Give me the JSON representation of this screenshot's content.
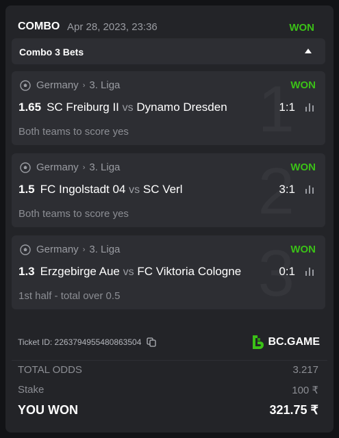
{
  "header": {
    "title": "COMBO",
    "date": "Apr 28, 2023, 23:36",
    "status": "WON"
  },
  "combo_bar": {
    "label": "Combo 3 Bets"
  },
  "bets": [
    {
      "number": "1",
      "country": "Germany",
      "league": "3. Liga",
      "status": "WON",
      "odds": "1.65",
      "home": "SC Freiburg II",
      "vs": "vs",
      "away": "Dynamo Dresden",
      "score": "1:1",
      "market": "Both teams to score yes"
    },
    {
      "number": "2",
      "country": "Germany",
      "league": "3. Liga",
      "status": "WON",
      "odds": "1.5",
      "home": "FC Ingolstadt 04",
      "vs": "vs",
      "away": "SC Verl",
      "score": "3:1",
      "market": "Both teams to score yes"
    },
    {
      "number": "3",
      "country": "Germany",
      "league": "3. Liga",
      "status": "WON",
      "odds": "1.3",
      "home": "Erzgebirge Aue",
      "vs": "vs",
      "away": "FC Viktoria Cologne",
      "score": "0:1",
      "market": "1st half - total over 0.5"
    }
  ],
  "ticket": {
    "label": "Ticket ID: 226379495548086350​4",
    "brand": "BC.GAME"
  },
  "summary": {
    "total_odds_label": "TOTAL ODDS",
    "total_odds_value": "3.217",
    "stake_label": "Stake",
    "stake_value": "100 ₹",
    "won_label": "YOU WON",
    "won_value": "321.75 ₹"
  },
  "colors": {
    "accent_green": "#3bc117",
    "background": "#232428",
    "panel": "#2d2e33"
  },
  "icons": [
    "soccer-ball-icon",
    "stats-icon",
    "copy-icon",
    "bc-game-logo",
    "caret-up-icon"
  ]
}
